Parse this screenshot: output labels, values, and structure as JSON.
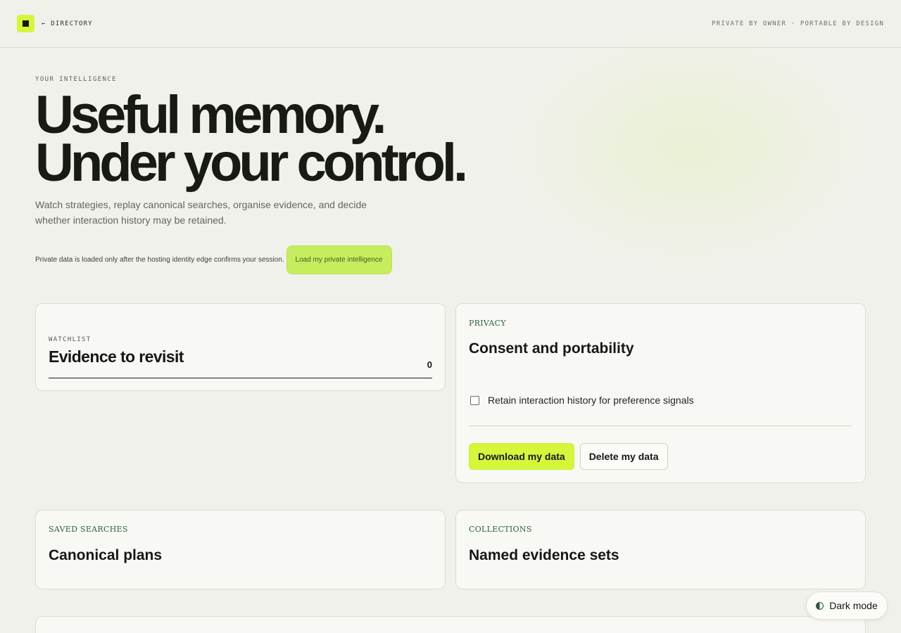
{
  "header": {
    "back_link": "← DIRECTORY",
    "tagline": "PRIVATE BY OWNER · PORTABLE BY DESIGN",
    "logo_icon": "square-logo-icon"
  },
  "hero": {
    "eyebrow": "YOUR INTELLIGENCE",
    "headline_line1": "Useful memory.",
    "headline_line2": "Under your control.",
    "lede": "Watch strategies, replay canonical searches, organise evidence, and decide whether interaction history may be retained.",
    "load_note": "Private data is loaded only after the hosting identity edge confirms your session.",
    "load_button": "Load my private intelligence"
  },
  "watchlist": {
    "label": "WATCHLIST",
    "title": "Evidence to revisit",
    "count": "0"
  },
  "privacy": {
    "label": "PRIVACY",
    "title": "Consent and portability",
    "consent_label": "Retain interaction history for preference signals",
    "consent_checked": false,
    "download_button": "Download my data",
    "delete_button": "Delete my data"
  },
  "saved_searches": {
    "label": "SAVED SEARCHES",
    "title": "Canonical plans"
  },
  "collections": {
    "label": "COLLECTIONS",
    "title": "Named evidence sets"
  },
  "theme_toggle": {
    "label": "Dark mode",
    "icon": "half-circle-icon"
  },
  "colors": {
    "accent": "#d4f73a",
    "background": "#f1f1ec",
    "label_green": "#2e6040"
  }
}
